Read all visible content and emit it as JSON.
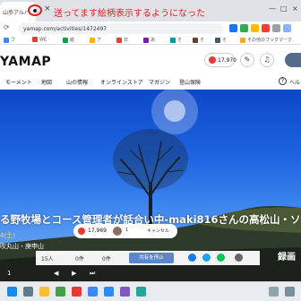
{
  "browser": {
    "tab_title": "山歩アルバ",
    "tab_close": "×",
    "annotation": "送ってます絵柄表示するようになった",
    "url": "yamap.com/activities/1472497",
    "bookmarks": [
      "ブ",
      "WE",
      "紙",
      "ア",
      "日",
      "あ",
      "そ",
      "そ",
      "そ",
      "その他のブックマーク"
    ],
    "window_controls": [
      "—",
      "□",
      "×"
    ]
  },
  "site": {
    "logo": "YAMAP",
    "points": "17,970",
    "menu": [
      "モーメント",
      "地図",
      "山の情報",
      "オンラインストア",
      "マガジン",
      "登山保険",
      "ヘルプ"
    ]
  },
  "hero": {
    "title": "る野牧場とコース管理者が話合い中-maki816さんの高松山・ソ",
    "date": "4(土)",
    "location": "吹丸山・庚申山",
    "likes": "17,969",
    "count": "1",
    "cancel": "キャンセル",
    "record": "録画"
  },
  "toolbar": {
    "items": [
      "15人",
      "0件",
      "0件"
    ],
    "share": "共有を停止"
  },
  "player": [
    "1",
    "◀",
    "▶",
    "⏭"
  ],
  "colors": {
    "accent": "#e53935",
    "annotation": "#e02020",
    "sky": "#1c64e0"
  }
}
